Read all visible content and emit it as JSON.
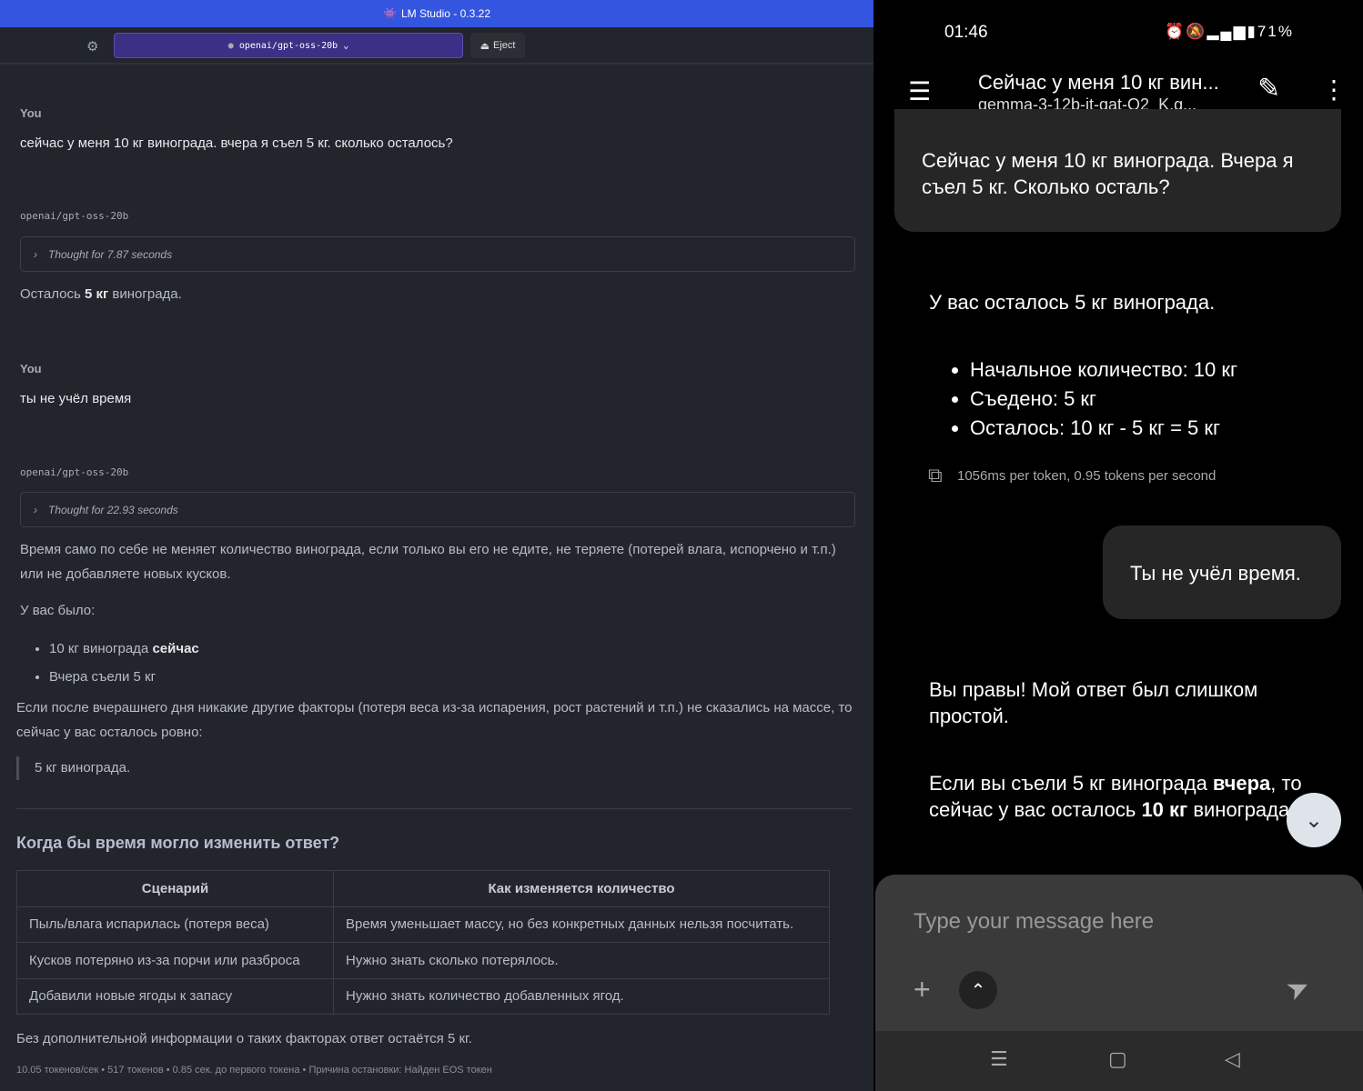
{
  "desktop": {
    "app_title": "LM Studio - 0.3.22",
    "model": "openai/gpt-oss-20b",
    "eject_label": "Eject",
    "messages": [
      {
        "author": "You",
        "text": "сейчас у меня 10 кг винограда. вчера я съел 5 кг. сколько осталось?"
      },
      {
        "author": "openai/gpt-oss-20b",
        "thought": "Thought for 7.87 seconds",
        "text_pre": "Осталось ",
        "text_bold": "5 кг",
        "text_post": " винограда."
      },
      {
        "author": "You",
        "text": "ты не учёл время"
      },
      {
        "author": "openai/gpt-oss-20b",
        "thought": "Thought for 22.93 seconds"
      }
    ],
    "answer": {
      "p1": "Время само по себе не меняет количество винограда, если только вы его не едите, не теряете (потерей влага, испорчено и т.п.) или не добавляете новых кусков.",
      "p2": "У вас было:",
      "bullet1_pre": "10 кг винограда ",
      "bullet1_bold": "сейчас",
      "bullet2": "Вчера съели 5 кг",
      "p3": "Если после вчерашнего дня никакие другие факторы (потеря веса из-за испарения, рост растений и т.п.) не сказались на массе, то сейчас у вас осталось ровно:",
      "quote_bold": "5 кг винограда",
      "quote_post": ".",
      "heading": "Когда бы время могло изменить ответ?",
      "table": {
        "headers": [
          "Сценарий",
          "Как изменяется количество"
        ],
        "rows": [
          [
            "Пыль/влага испарилась (потеря веса)",
            "Время уменьшает массу, но без конкретных данных нельзя посчитать."
          ],
          [
            "Кусков потеряно из-за порчи или разброса",
            "Нужно знать сколько потерялось."
          ],
          [
            "Добавили новые ягоды к запасу",
            "Нужно знать количество добавленных ягод."
          ]
        ]
      },
      "p4": "Без дополнительной информации о таких факторах ответ остаётся 5 кг.",
      "stats": "10.05 токенов/сек • 517 токенов • 0.85 сек. до первого токена • Причина остановки: Найден EOS токен"
    }
  },
  "mobile": {
    "time": "01:46",
    "battery": "71%",
    "chat_title": "Сейчас у меня 10 кг вин...",
    "model": "gemma-3-12b-it-qat-Q2_K.g...",
    "user1": "Сейчас у меня 10 кг винограда. Вчера я съел 5 кг. Сколько осталь?",
    "reply1": "У вас осталось 5 кг винограда.",
    "bullets": [
      "Начальное количество: 10 кг",
      "Съедено: 5 кг",
      "Осталось: 10 кг - 5 кг = 5 кг"
    ],
    "perf": "1056ms per token, 0.95 tokens per second",
    "user2": "Ты не учёл время.",
    "reply2a": "Вы правы! Мой ответ был слишком простой.",
    "reply2b_pre": "Если вы съели 5 кг винограда ",
    "reply2b_b1": "вчера",
    "reply2b_mid": ", то сейчас у вас осталось ",
    "reply2b_b2": "10 кг",
    "reply2b_post": " винограда.",
    "input_placeholder": "Type your message here"
  }
}
